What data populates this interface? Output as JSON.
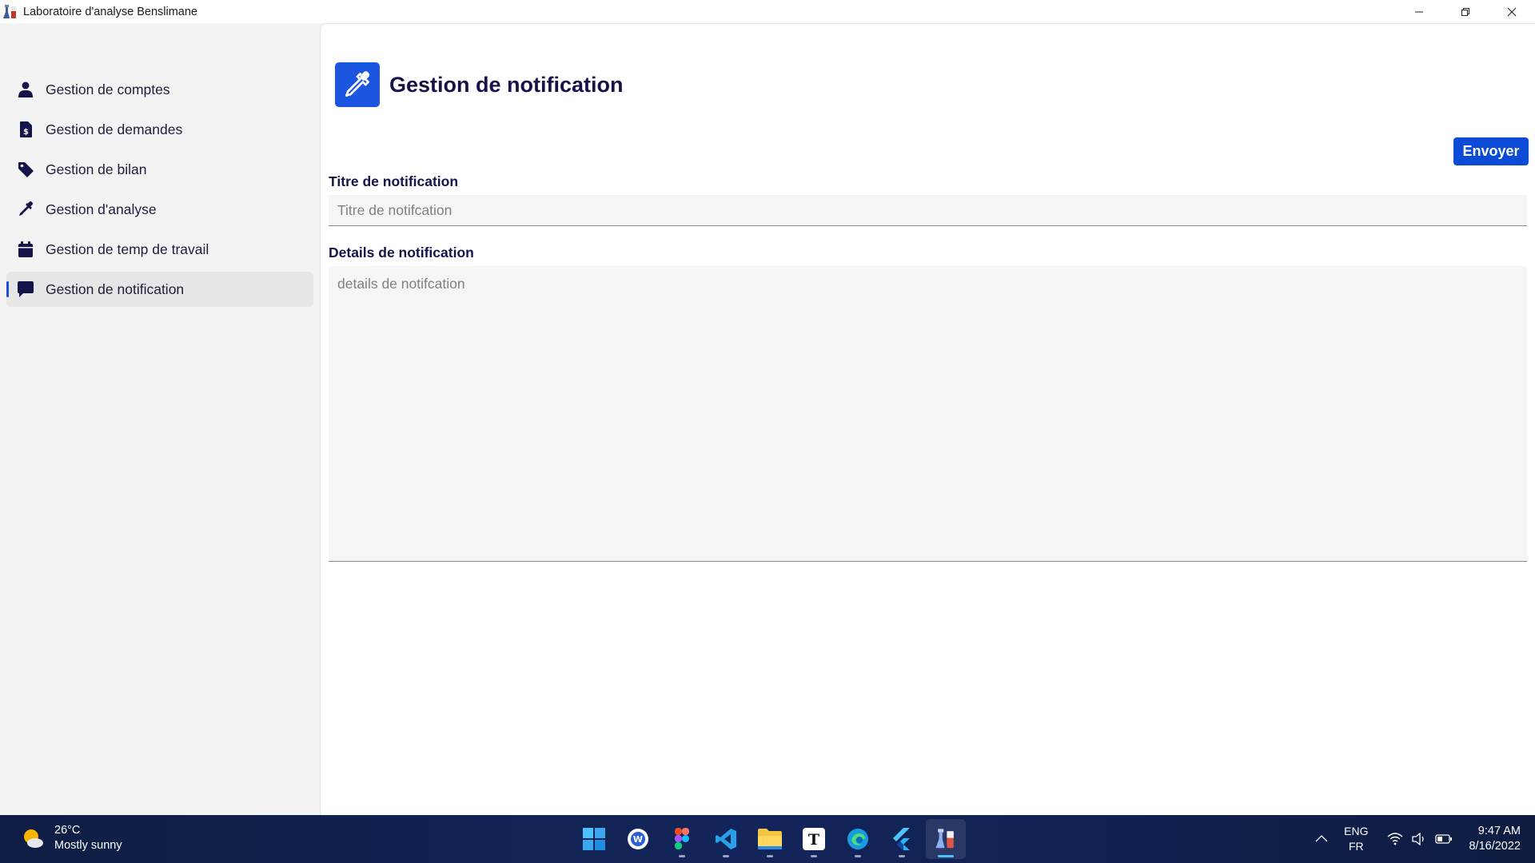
{
  "window": {
    "title": "Laboratoire d'analyse Benslimane"
  },
  "sidebar": {
    "items": [
      {
        "label": "Gestion de comptes",
        "icon": "user-icon"
      },
      {
        "label": "Gestion de demandes",
        "icon": "invoice-dollar-icon"
      },
      {
        "label": "Gestion de bilan",
        "icon": "tag-icon"
      },
      {
        "label": "Gestion d'analyse",
        "icon": "eyedropper-icon"
      },
      {
        "label": "Gestion de temp de travail",
        "icon": "calendar-icon"
      },
      {
        "label": "Gestion de notification",
        "icon": "message-icon",
        "active": true
      }
    ]
  },
  "main": {
    "title": "Gestion de notification",
    "send_label": "Envoyer",
    "title_field": {
      "label": "Titre de notification",
      "placeholder": "Titre de notifcation"
    },
    "details_field": {
      "label": "Details de notification",
      "placeholder": "details de notifcation"
    }
  },
  "taskbar": {
    "weather": {
      "temp": "26°C",
      "desc": "Mostly sunny"
    },
    "apps": [
      "windows-start-icon",
      "word-icon",
      "figma-icon",
      "vscode-icon",
      "file-explorer-icon",
      "typora-icon",
      "edge-icon",
      "flutter-icon",
      "lab-app-icon"
    ],
    "lang": {
      "primary": "ENG",
      "secondary": "FR"
    },
    "clock": {
      "time": "9:47 AM",
      "date": "8/16/2022"
    }
  },
  "colors": {
    "accent": "#1a56e0",
    "button": "#0b4bd6",
    "heading": "#14144a",
    "sidebar_bg": "#f3f3f3",
    "taskbar_bg": "#12245a"
  }
}
